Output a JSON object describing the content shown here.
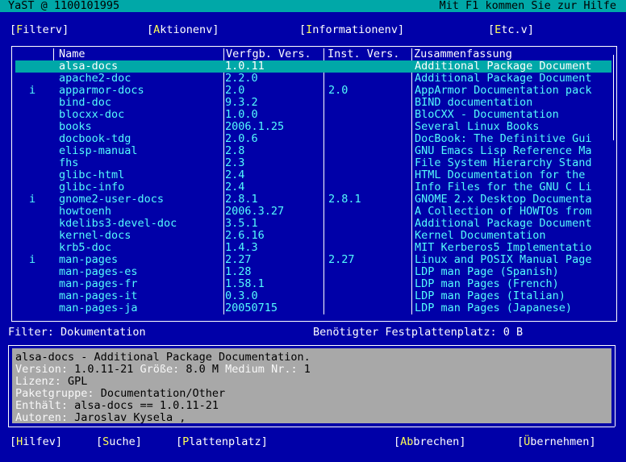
{
  "title_bar": {
    "left": "YaST @ 1100101995",
    "right": "Mit F1 kommen Sie zur Hilfe"
  },
  "menu": [
    {
      "pre": "[",
      "hot": "F",
      "rest": "ilter",
      "arrow": "v",
      "post": "]"
    },
    {
      "pre": "[",
      "hot": "A",
      "rest": "ktionen",
      "arrow": "v",
      "post": "]"
    },
    {
      "pre": "[",
      "hot": "I",
      "rest": "nformationen",
      "arrow": "v",
      "post": "]"
    },
    {
      "pre": "[",
      "hot": "E",
      "rest": "tc.",
      "arrow": "v",
      "post": "]"
    }
  ],
  "table": {
    "headers": [
      "Name",
      "Verfgb. Vers.",
      "Inst. Vers.",
      "Zusammenfassung"
    ],
    "rows": [
      {
        "status": "",
        "name": "alsa-docs",
        "avail": "1.0.11",
        "inst": "",
        "summary": "Additional Package Document"
      },
      {
        "status": "",
        "name": "apache2-doc",
        "avail": "2.2.0",
        "inst": "",
        "summary": "Additional Package Document"
      },
      {
        "status": "i",
        "name": "apparmor-docs",
        "avail": "2.0",
        "inst": "2.0",
        "summary": "AppArmor Documentation pack"
      },
      {
        "status": "",
        "name": "bind-doc",
        "avail": "9.3.2",
        "inst": "",
        "summary": "BIND documentation"
      },
      {
        "status": "",
        "name": "blocxx-doc",
        "avail": "1.0.0",
        "inst": "",
        "summary": "BloCXX - Documentation"
      },
      {
        "status": "",
        "name": "books",
        "avail": "2006.1.25",
        "inst": "",
        "summary": "Several Linux Books"
      },
      {
        "status": "",
        "name": "docbook-tdg",
        "avail": "2.0.6",
        "inst": "",
        "summary": "DocBook: The Definitive Gui"
      },
      {
        "status": "",
        "name": "elisp-manual",
        "avail": "2.8",
        "inst": "",
        "summary": "GNU Emacs Lisp Reference Ma"
      },
      {
        "status": "",
        "name": "fhs",
        "avail": "2.3",
        "inst": "",
        "summary": "File System Hierarchy Stand"
      },
      {
        "status": "",
        "name": "glibc-html",
        "avail": "2.4",
        "inst": "",
        "summary": "HTML Documentation for the"
      },
      {
        "status": "",
        "name": "glibc-info",
        "avail": "2.4",
        "inst": "",
        "summary": "Info Files for the GNU C Li"
      },
      {
        "status": "i",
        "name": "gnome2-user-docs",
        "avail": "2.8.1",
        "inst": "2.8.1",
        "summary": "GNOME 2.x Desktop Documenta"
      },
      {
        "status": "",
        "name": "howtoenh",
        "avail": "2006.3.27",
        "inst": "",
        "summary": "A Collection of HOWTOs from"
      },
      {
        "status": "",
        "name": "kdelibs3-devel-doc",
        "avail": "3.5.1",
        "inst": "",
        "summary": "Additional Package Document"
      },
      {
        "status": "",
        "name": "kernel-docs",
        "avail": "2.6.16",
        "inst": "",
        "summary": "Kernel Documentation"
      },
      {
        "status": "",
        "name": "krb5-doc",
        "avail": "1.4.3",
        "inst": "",
        "summary": "MIT Kerberos5 Implementatio"
      },
      {
        "status": "i",
        "name": "man-pages",
        "avail": "2.27",
        "inst": "2.27",
        "summary": "Linux and POSIX Manual Page"
      },
      {
        "status": "",
        "name": "man-pages-es",
        "avail": "1.28",
        "inst": "",
        "summary": "LDP man Page (Spanish)"
      },
      {
        "status": "",
        "name": "man-pages-fr",
        "avail": "1.58.1",
        "inst": "",
        "summary": "LDP man Pages (French)"
      },
      {
        "status": "",
        "name": "man-pages-it",
        "avail": "0.3.0",
        "inst": "",
        "summary": "LDP man Pages (Italian)"
      },
      {
        "status": "",
        "name": "man-pages-ja",
        "avail": "20050715",
        "inst": "",
        "summary": "LDP man Pages (Japanese)"
      }
    ]
  },
  "filter_text": "Filter: Dokumentation",
  "disk_text": "Benötigter Festplattenplatz: 0 B",
  "details": {
    "line1": "alsa-docs - Additional Package Documentation.",
    "version_label": "Version:",
    "version": "1.0.11-21",
    "size_label": "Größe:",
    "size": "8.0 M",
    "medium_label": "Medium Nr.:",
    "medium": "1",
    "license_label": "Lizenz:",
    "license": "GPL",
    "group_label": "Paketgruppe:",
    "group": "Documentation/Other",
    "contains_label": "Enthält:",
    "contains": "alsa-docs == 1.0.11-21",
    "authors_label": "Autoren:",
    "authors": "Jaroslav Kysela ,"
  },
  "buttons": [
    {
      "pre": "[",
      "hot": "H",
      "rest": "ilfe",
      "arrow": "v",
      "post": "]"
    },
    {
      "pre": "[",
      "hot": "S",
      "rest": "uche",
      "arrow": "",
      "post": "]"
    },
    {
      "pre": "[",
      "hot": "P",
      "rest": "lattenplatz",
      "arrow": "",
      "post": "]"
    },
    {
      "pre": "[",
      "hot": "Ab",
      "rest": "brechen",
      "arrow": "",
      "post": "]"
    },
    {
      "pre": "[",
      "hot": "Ü",
      "rest": "bernehmen",
      "arrow": "",
      "post": "]"
    }
  ],
  "colors": {
    "background": "#0000a8",
    "highlight": "#00a8a8",
    "text": "#54fcfc",
    "hotkey": "#ffff54",
    "detail_bg": "#a8a8a8"
  }
}
